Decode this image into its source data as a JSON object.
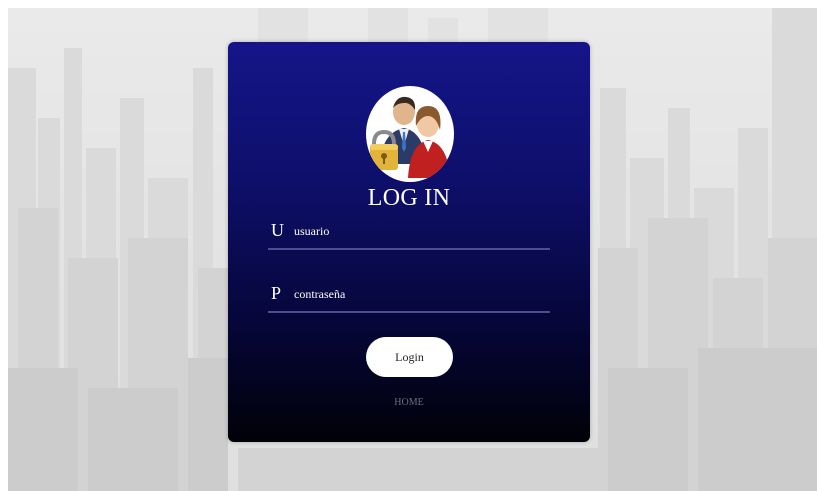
{
  "login": {
    "title": "LOG IN",
    "username": {
      "letter": "U",
      "placeholder": "usuario",
      "value": ""
    },
    "password": {
      "letter": "P",
      "placeholder": "contraseña",
      "value": ""
    },
    "submit_label": "Login",
    "home_link": "HOME",
    "avatar_icon": "users-lock-icon"
  },
  "colors": {
    "card_top": "#15158a",
    "card_bottom": "#010108",
    "field_underline": "#4a4f8f",
    "button_bg": "#ffffff"
  }
}
